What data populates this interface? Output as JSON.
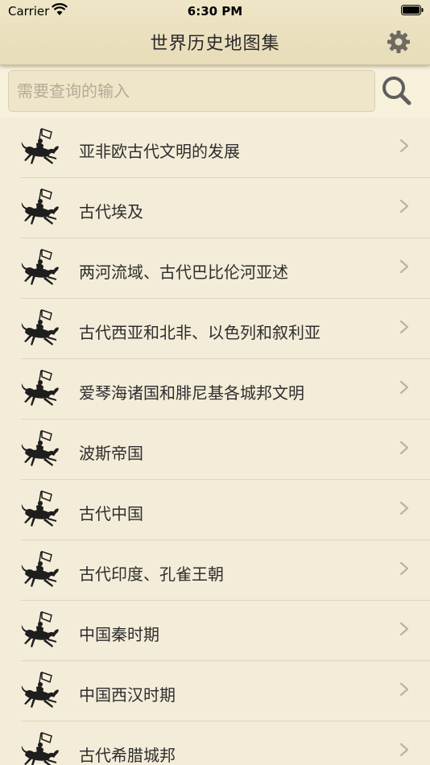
{
  "status": {
    "carrier": "Carrier",
    "time": "6:30 PM"
  },
  "nav": {
    "title": "世界历史地图集",
    "settings_icon": "gear-icon"
  },
  "search": {
    "placeholder": "需要查询的输入",
    "value": "",
    "button_icon": "search-icon"
  },
  "list": {
    "items": [
      {
        "label": "亚非欧古代文明的发展"
      },
      {
        "label": "古代埃及"
      },
      {
        "label": "两河流域、古代巴比伦河亚述"
      },
      {
        "label": "古代西亚和北非、以色列和叙利亚"
      },
      {
        "label": "爱琴海诸国和腓尼基各城邦文明"
      },
      {
        "label": "波斯帝国"
      },
      {
        "label": "古代中国"
      },
      {
        "label": "古代印度、孔雀王朝"
      },
      {
        "label": "中国秦时期"
      },
      {
        "label": "中国西汉时期"
      },
      {
        "label": "古代希腊城邦"
      }
    ],
    "row_icon": "horse-rider-icon",
    "chevron_icon": "chevron-right-icon"
  },
  "colors": {
    "background": "#f3ecd8",
    "nav_bar": "#e7dcb8",
    "text": "#2e2e2e",
    "placeholder": "#b3ab99"
  }
}
